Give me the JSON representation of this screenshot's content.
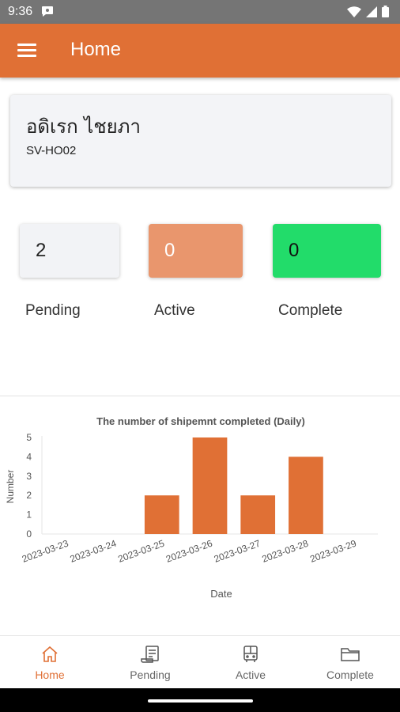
{
  "status_bar": {
    "time": "9:36"
  },
  "app_bar": {
    "title": "Home"
  },
  "user": {
    "name": "อดิเรก ไชยภา",
    "code": "SV-HO02"
  },
  "stats": [
    {
      "value": "2",
      "label": "Pending"
    },
    {
      "value": "0",
      "label": "Active"
    },
    {
      "value": "0",
      "label": "Complete"
    }
  ],
  "chart_data": {
    "type": "bar",
    "title": "The number of shipemnt completed (Daily)",
    "xlabel": "Date",
    "ylabel": "Number",
    "categories": [
      "2023-03-23",
      "2023-03-24",
      "2023-03-25",
      "2023-03-26",
      "2023-03-27",
      "2023-03-28",
      "2023-03-29"
    ],
    "values": [
      0,
      0,
      2,
      5,
      2,
      4,
      0
    ],
    "ylim": [
      0,
      5
    ],
    "yticks": [
      "0",
      "1",
      "2",
      "3",
      "4",
      "5"
    ],
    "bar_color": "#e07035",
    "grid": false
  },
  "bottom_nav": [
    {
      "label": "Home",
      "icon": "home-icon"
    },
    {
      "label": "Pending",
      "icon": "receipt-icon"
    },
    {
      "label": "Active",
      "icon": "bus-icon"
    },
    {
      "label": "Complete",
      "icon": "folder-icon"
    }
  ],
  "colors": {
    "accent": "#e07035",
    "active": "#e9966d",
    "complete": "#22dc6a"
  }
}
